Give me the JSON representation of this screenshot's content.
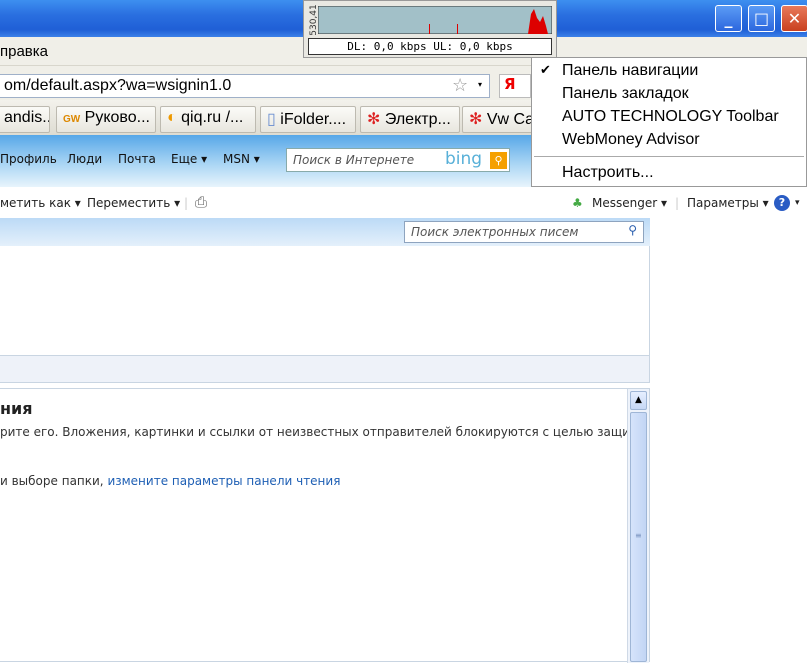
{
  "window": {
    "minimize": "_",
    "maximize": "□",
    "close": "✕"
  },
  "menubar": {
    "item": "правка"
  },
  "address": {
    "url": "om/default.aspx?wa=wsignin1.0",
    "yandex": "Я"
  },
  "bookmarks": [
    {
      "label": "andis...",
      "icon": "none"
    },
    {
      "label": "Руково...",
      "icon": "gw-icon"
    },
    {
      "label": "qiq.ru /...",
      "icon": "qiq-icon"
    },
    {
      "label": "iFolder....",
      "icon": "page-icon"
    },
    {
      "label": "Электр...",
      "icon": "flower-icon"
    },
    {
      "label": "Vw Ca",
      "icon": "flower-icon"
    }
  ],
  "hotmail_nav": {
    "items": [
      "Профиль",
      "Люди",
      "Почта",
      "Еще ▾",
      "MSN ▾"
    ],
    "search_placeholder": "Поиск в Интернете",
    "search_brand": "bing"
  },
  "toolbar": {
    "mark_as": "метить как ▾",
    "move": "Переместить ▾",
    "messenger": "Messenger ▾",
    "params": "Параметры ▾",
    "help": "?"
  },
  "mail": {
    "search_placeholder": "Поиск электронных писем"
  },
  "reading_pane": {
    "title": "ния",
    "text": "рите его. Вложения, картинки и ссылки от неизвестных отправителей блокируются с целью защиты",
    "text2": "и выборе папки, ",
    "link": "измените параметры панели чтения"
  },
  "net_meter": {
    "scale": "530,41",
    "status": "DL: 0,0 kbps  UL: 0,0 kbps"
  },
  "context_menu": {
    "items": [
      {
        "label": "Панель навигации",
        "checked": true
      },
      {
        "label": "Панель закладок",
        "checked": false
      },
      {
        "label": "AUTO TECHNOLOGY Toolbar",
        "checked": false
      },
      {
        "label": "WebMoney Advisor",
        "checked": false
      }
    ],
    "customize": "Настроить...",
    "check": "✔"
  }
}
